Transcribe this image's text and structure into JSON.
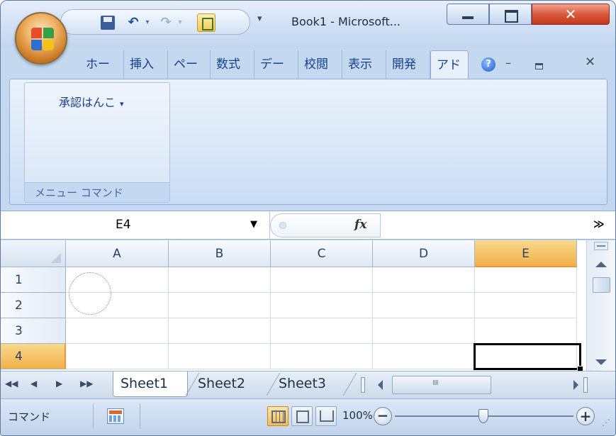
{
  "window": {
    "title": "Book1 - Microsoft...",
    "accent_color": "#c4d8f0",
    "close_color": "#c33a1b"
  },
  "qat": {
    "save_icon": "save-icon",
    "undo_icon": "undo-icon",
    "redo_icon": "redo-icon",
    "form_icon": "form-icon",
    "customize_glyph": "▾"
  },
  "ribbon": {
    "tabs": [
      {
        "label": "ホー",
        "active": false
      },
      {
        "label": "挿入",
        "active": false
      },
      {
        "label": "ペー",
        "active": false
      },
      {
        "label": "数式",
        "active": false
      },
      {
        "label": "デー",
        "active": false
      },
      {
        "label": "校閲",
        "active": false
      },
      {
        "label": "表示",
        "active": false
      },
      {
        "label": "開発",
        "active": false
      },
      {
        "label": "アド",
        "active": true
      }
    ],
    "help_glyph": "?",
    "group": {
      "button_label": "承認はんこ",
      "button_arrow": "▾",
      "group_label": "メニュー コマンド"
    }
  },
  "formula_bar": {
    "name_box_value": "E4",
    "fx_label": "fx",
    "formula_value": "",
    "expand_glyph": "≫"
  },
  "grid": {
    "columns": [
      "A",
      "B",
      "C",
      "D",
      "E"
    ],
    "active_column": "E",
    "rows": [
      "1",
      "2",
      "3",
      "4"
    ],
    "active_row": "4",
    "selected_cell": "E4"
  },
  "sheets": {
    "tabs": [
      "Sheet1",
      "Sheet2",
      "Sheet3"
    ],
    "active": "Sheet1"
  },
  "statusbar": {
    "mode": "コマンド",
    "zoom": "100%",
    "zoom_out": "−",
    "zoom_in": "+"
  }
}
